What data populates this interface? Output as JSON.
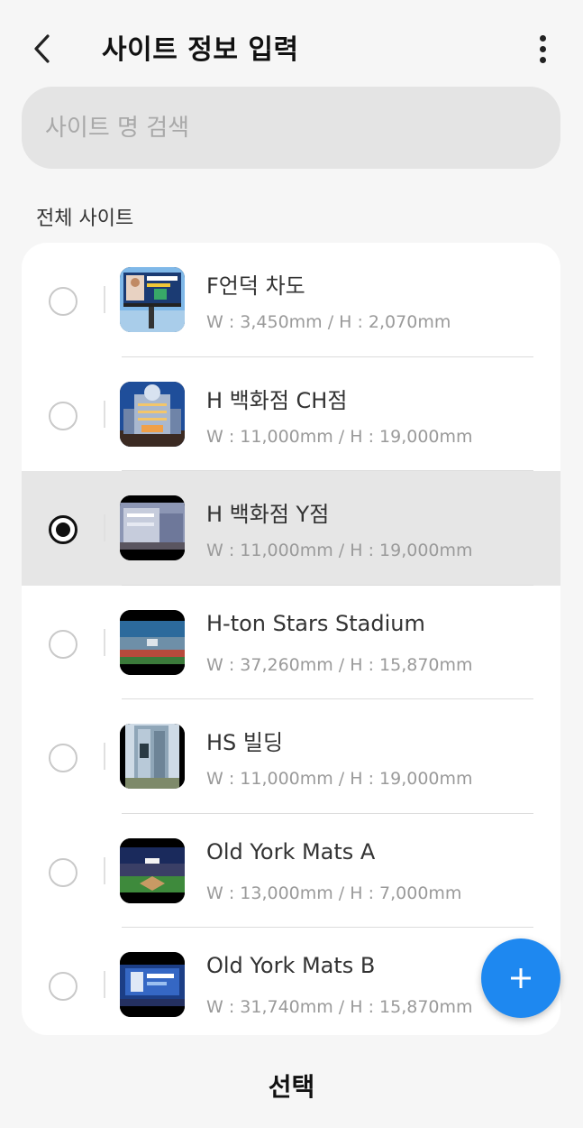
{
  "header": {
    "title": "사이트 정보 입력",
    "back_icon": "chevron-left-icon",
    "more_icon": "more-vertical-icon"
  },
  "search": {
    "placeholder": "사이트 명 검색",
    "value": ""
  },
  "section_label": "전체 사이트",
  "sites": [
    {
      "name": "F언덕 차도",
      "size": "W : 3,450mm / H : 2,070mm",
      "selected": false,
      "thumbnail": "billboard-image"
    },
    {
      "name": "H 백화점 CH점",
      "size": "W : 11,000mm / H : 19,000mm",
      "selected": false,
      "thumbnail": "department-store-night-image"
    },
    {
      "name": "H 백화점 Y점",
      "size": "W : 11,000mm / H : 19,000mm",
      "selected": true,
      "thumbnail": "department-store-street-image"
    },
    {
      "name": "H-ton Stars Stadium",
      "size": "W : 37,260mm / H : 15,870mm",
      "selected": false,
      "thumbnail": "stadium-image"
    },
    {
      "name": "HS 빌딩",
      "size": "W : 11,000mm / H : 19,000mm",
      "selected": false,
      "thumbnail": "office-building-image"
    },
    {
      "name": "Old York Mats A",
      "size": "W : 13,000mm / H : 7,000mm",
      "selected": false,
      "thumbnail": "ballpark-night-image"
    },
    {
      "name": "Old York Mats B",
      "size": "W : 31,740mm / H : 15,870mm",
      "selected": false,
      "thumbnail": "scoreboard-image"
    }
  ],
  "fab": {
    "icon": "plus-icon"
  },
  "bottom_button": {
    "label": "선택"
  },
  "colors": {
    "accent": "#1e88f0",
    "background": "#f6f6f6",
    "card": "#ffffff",
    "selected_row": "#e6e6e6"
  }
}
